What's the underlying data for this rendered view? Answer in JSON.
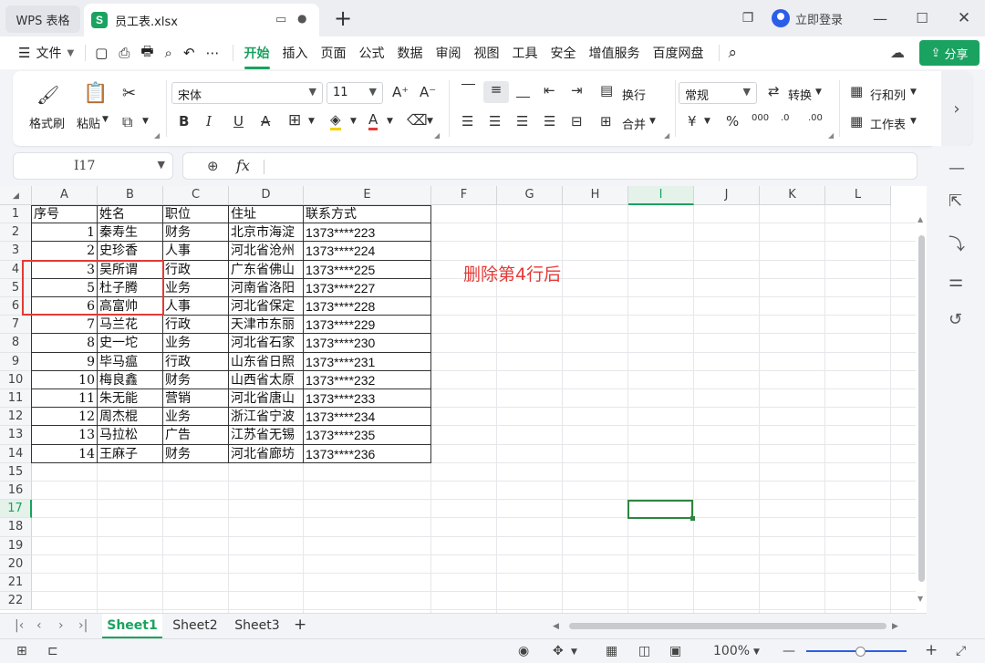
{
  "window": {
    "home_tab": "WPS 表格",
    "file_tab": "员工表.xlsx",
    "file_logo": "S",
    "new_tab_icon": "plus-icon",
    "login_label": "立即登录"
  },
  "menu": {
    "file_label": "文件",
    "items": [
      "开始",
      "插入",
      "页面",
      "公式",
      "数据",
      "审阅",
      "视图",
      "工具",
      "安全",
      "增值服务",
      "百度网盘"
    ],
    "active": "开始",
    "share_label": "分享"
  },
  "ribbon": {
    "format_painter": "格式刷",
    "paste": "粘贴",
    "font_name": "宋体",
    "font_size": "11",
    "wrap_text": "换行",
    "merge": "合并",
    "number_format": "常规",
    "convert": "转换",
    "rows_cols": "行和列",
    "worksheet": "工作表"
  },
  "formula_bar": {
    "cell_ref": "I17",
    "fx_label": "fx",
    "formula": ""
  },
  "sheet": {
    "columns": [
      "A",
      "B",
      "C",
      "D",
      "E",
      "F",
      "G",
      "H",
      "I",
      "J",
      "K",
      "L"
    ],
    "active_column": "I",
    "active_row": "17",
    "row_numbers": [
      "1",
      "2",
      "3",
      "4",
      "5",
      "6",
      "7",
      "8",
      "9",
      "10",
      "11",
      "12",
      "13",
      "14",
      "15",
      "16",
      "17",
      "18",
      "19",
      "20",
      "21",
      "22"
    ],
    "header": [
      "序号",
      "姓名",
      "职位",
      "住址",
      "联系方式"
    ],
    "rows": [
      [
        "1",
        "秦寿生",
        "财务",
        "北京市海淀",
        "1373****223"
      ],
      [
        "2",
        "史珍香",
        "人事",
        "河北省沧州",
        "1373****224"
      ],
      [
        "3",
        "吴所谓",
        "行政",
        "广东省佛山",
        "1373****225"
      ],
      [
        "5",
        "杜子腾",
        "业务",
        "河南省洛阳",
        "1373****227"
      ],
      [
        "6",
        "高富帅",
        "人事",
        "河北省保定",
        "1373****228"
      ],
      [
        "7",
        "马兰花",
        "行政",
        "天津市东丽",
        "1373****229"
      ],
      [
        "8",
        "史一坨",
        "业务",
        "河北省石家",
        "1373****230"
      ],
      [
        "9",
        "毕马瘟",
        "行政",
        "山东省日照",
        "1373****231"
      ],
      [
        "10",
        "梅良鑫",
        "财务",
        "山西省太原",
        "1373****232"
      ],
      [
        "11",
        "朱无能",
        "营销",
        "河北省唐山",
        "1373****233"
      ],
      [
        "12",
        "周杰棍",
        "业务",
        "浙江省宁波",
        "1373****234"
      ],
      [
        "13",
        "马拉松",
        "广告",
        "江苏省无锡",
        "1373****235"
      ],
      [
        "14",
        "王麻子",
        "财务",
        "河北省廊坊",
        "1373****236"
      ]
    ],
    "annotation": "删除第4行后",
    "annotation_color": "#e53935"
  },
  "sheet_tabs": [
    "Sheet1",
    "Sheet2",
    "Sheet3"
  ],
  "active_sheet": "Sheet1",
  "status": {
    "zoom": "100%"
  },
  "colors": {
    "accent": "#1aa260",
    "link": "#2b5ee8",
    "highlight": "#e53935"
  }
}
